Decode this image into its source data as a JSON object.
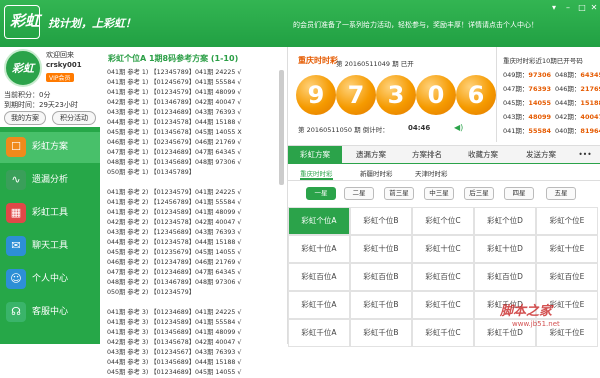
{
  "header": {
    "logo": "彩虹",
    "slogan": "找计划，上彩虹！",
    "notice": "的会员们准备了一系列给力活动，轻松参与，奖励丰厚！详情请点击个人中心！"
  },
  "user": {
    "welcome": "欢迎回来",
    "name": "crsky001",
    "vip": "VIP会员",
    "points": "当前积分：0分",
    "expire": "到期时间：29天23小时",
    "btn_plan": "我的方案",
    "btn_points": "积分活动"
  },
  "nav": [
    {
      "label": "彩虹方案",
      "icon": "☐"
    },
    {
      "label": "遗漏分析",
      "icon": "∿"
    },
    {
      "label": "彩虹工具",
      "icon": "▦"
    },
    {
      "label": "聊天工具",
      "icon": "✉"
    },
    {
      "label": "个人中心",
      "icon": "☺"
    },
    {
      "label": "客服中心",
      "icon": "☊"
    }
  ],
  "middle": {
    "title": "彩虹个位A 1期8码参考方案 (1-10)",
    "rows": [
      "041期 参考 1) 【12345789】041期 24225 √",
      "041期 参考 1) 【01245679】041期 55584 √",
      "041期 参考 1) 【01234579】041期 48099 √",
      "042期 参考 1) 【01346789】042期 40047 √",
      "043期 参考 1) 【01234689】043期 76393 √",
      "044期 参考 1) 【01234578】044期 15188 √",
      "045期 参考 1) 【01345678】045期 14055 X",
      "046期 参考 1) 【02345679】046期 21769 √",
      "047期 参考 1) 【01234689】047期 64345 √",
      "048期 参考 1) 【01345689】048期 97306 √",
      "050期 参考 1) 【01345789】",
      "",
      "041期 参考 2) 【01234579】041期 24225 √",
      "041期 参考 2) 【12456789】041期 55584 √",
      "041期 参考 2) 【01234589】041期 48099 √",
      "042期 参考 2) 【01234578】042期 40047 √",
      "043期 参考 2) 【12345689】043期 76393 √",
      "044期 参考 2) 【01234578】044期 15188 √",
      "045期 参考 2) 【01235679】045期 14055 √",
      "046期 参考 2) 【01234789】046期 21769 √",
      "047期 参考 2) 【01234689】047期 64345 √",
      "048期 参考 2) 【01346789】048期 97306 √",
      "050期 参考 2) 【01234579】",
      "",
      "041期 参考 3) 【01234689】041期 24225 √",
      "041期 参考 3) 【01234589】041期 55584 √",
      "041期 参考 3) 【01345689】041期 48099 √",
      "042期 参考 3) 【01345678】042期 40047 √",
      "043期 参考 3) 【01234567】043期 76393 √",
      "044期 参考 3) 【01345689】044期 15188 √",
      "045期 参考 3) 【01234689】045期 14055 √"
    ]
  },
  "lottery": {
    "name": "重庆时时彩",
    "current": "第 20160511049 期 已开",
    "balls": [
      "9",
      "7",
      "3",
      "0",
      "6"
    ],
    "next": "第 20160511050 期 倒计时：",
    "countdown": "04:46"
  },
  "history": {
    "title": "重庆时时彩近10期已开号码",
    "rows": [
      {
        "issue": "049期：",
        "num": "97306"
      },
      {
        "issue": "048期：",
        "num": "64345"
      },
      {
        "issue": "047期：",
        "num": "76393"
      },
      {
        "issue": "046期：",
        "num": "21769"
      },
      {
        "issue": "045期：",
        "num": "14055"
      },
      {
        "issue": "044期：",
        "num": "15188"
      },
      {
        "issue": "043期：",
        "num": "48099"
      },
      {
        "issue": "042期：",
        "num": "40047"
      },
      {
        "issue": "041期：",
        "num": "55584"
      },
      {
        "issue": "040期：",
        "num": "81964"
      }
    ]
  },
  "tabs": [
    "彩虹方案",
    "遗漏方案",
    "方案排名",
    "收藏方案",
    "发送方案",
    "•••"
  ],
  "subtabs": [
    "重庆时时彩",
    "新疆时时彩",
    "天津时时彩"
  ],
  "phases": [
    "一星",
    "二星",
    "前三星",
    "中三星",
    "后三星",
    "四星",
    "五星"
  ],
  "cells": [
    [
      "彩虹个位A",
      "彩虹个位B",
      "彩虹个位C",
      "彩虹个位D",
      "彩虹个位E"
    ],
    [
      "彩虹十位A",
      "彩虹十位B",
      "彩虹十位C",
      "彩虹十位D",
      "彩虹十位E"
    ],
    [
      "彩虹百位A",
      "彩虹百位B",
      "彩虹百位C",
      "彩虹百位D",
      "彩虹百位E"
    ],
    [
      "彩虹千位A",
      "彩虹千位B",
      "彩虹千位C",
      "彩虹千位D",
      "彩虹千位E"
    ],
    [
      "彩虹千位A",
      "彩虹千位B",
      "彩虹千位C",
      "彩虹千位D",
      "彩虹千位E"
    ]
  ],
  "watermark": {
    "text": "脚本之家",
    "url": "www.jb51.net"
  }
}
